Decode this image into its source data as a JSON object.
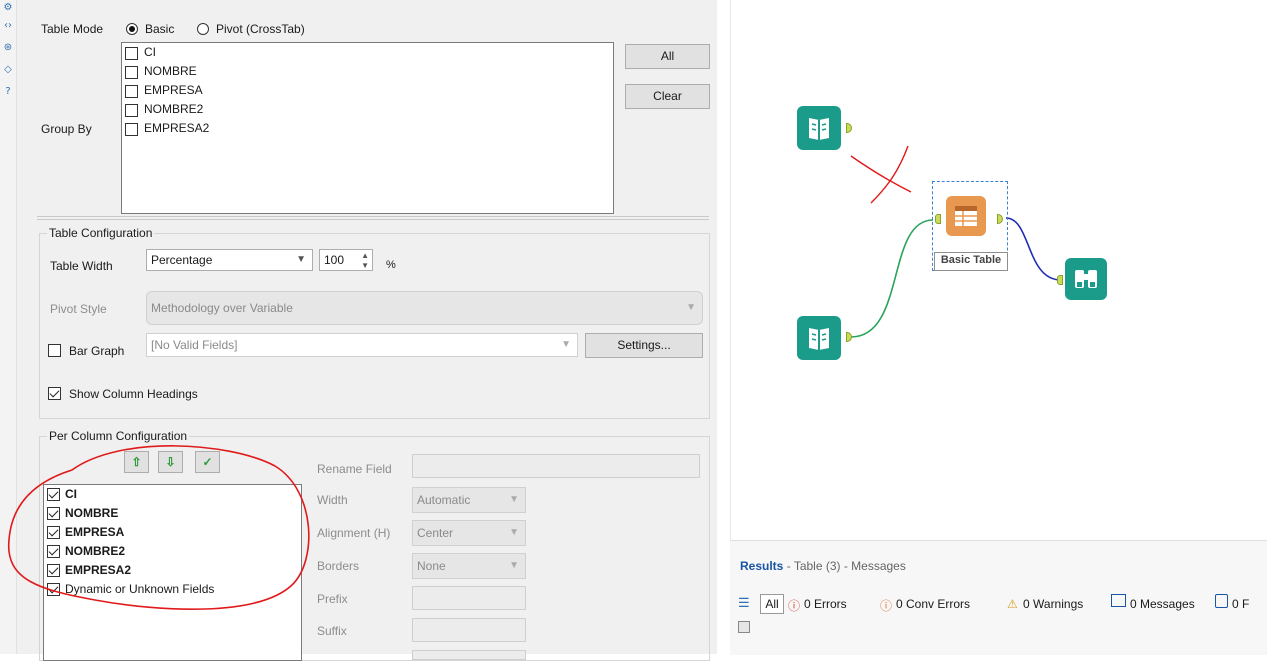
{
  "table_mode": {
    "label": "Table Mode",
    "options": [
      "Basic",
      "Pivot (CrossTab)"
    ],
    "selected": "Basic"
  },
  "group_by": {
    "label": "Group By",
    "fields": [
      "CI",
      "NOMBRE",
      "EMPRESA",
      "NOMBRE2",
      "EMPRESA2"
    ],
    "all_button": "All",
    "clear_button": "Clear"
  },
  "table_configuration": {
    "title": "Table Configuration",
    "table_width_label": "Table Width",
    "table_width_mode": "Percentage",
    "table_width_value": "100",
    "table_width_unit": "%",
    "pivot_style_label": "Pivot Style",
    "pivot_style_value": "Methodology over Variable",
    "bar_graph_label": "Bar Graph",
    "bar_graph_value": "[No Valid Fields]",
    "settings_button": "Settings...",
    "show_column_headings_label": "Show Column Headings"
  },
  "per_column": {
    "title": "Per Column Configuration",
    "fields": [
      "CI",
      "NOMBRE",
      "EMPRESA",
      "NOMBRE2",
      "EMPRESA2"
    ],
    "dynamic_label": "Dynamic or Unknown Fields",
    "rename_field_label": "Rename Field",
    "width_label": "Width",
    "width_value": "Automatic",
    "alignment_label": "Alignment (H)",
    "alignment_value": "Center",
    "borders_label": "Borders",
    "borders_value": "None",
    "prefix_label": "Prefix",
    "suffix_label": "Suffix"
  },
  "canvas": {
    "basic_table_label": "Basic Table",
    "colors": {
      "input_tool": "#1b9b8a",
      "table_tool": "#e8984f",
      "browse_tool": "#1b9b8a",
      "green_connection": "#2aa35a",
      "blue_connection": "#1f2db3",
      "annotation_red": "#e01a1a"
    }
  },
  "results": {
    "title": "Results",
    "subtitle": "- Table (3) - Messages",
    "all_label": "All",
    "errors": "0 Errors",
    "conv_errors": "0 Conv Errors",
    "warnings": "0 Warnings",
    "messages": "0 Messages",
    "files_partial": "0 F"
  }
}
